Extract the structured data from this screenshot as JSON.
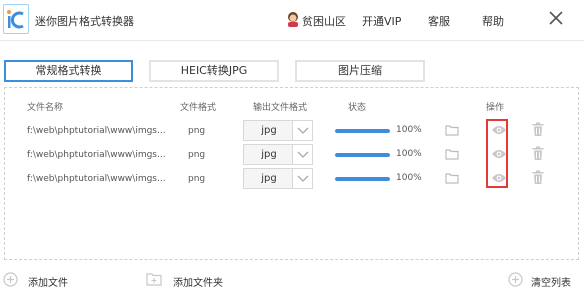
{
  "app": {
    "title": "迷你图片格式转换器"
  },
  "user": {
    "name": "贫困山区"
  },
  "nav": {
    "vip": "开通VIP",
    "support": "客服",
    "help": "帮助"
  },
  "tabs": [
    {
      "label": "常规格式转换",
      "active": true
    },
    {
      "label": "HEIC转换JPG",
      "active": false
    },
    {
      "label": "图片压缩",
      "active": false
    }
  ],
  "table": {
    "headers": {
      "name": "文件名称",
      "format": "文件格式",
      "output": "输出文件格式",
      "status": "状态",
      "actions": "操作"
    },
    "rows": [
      {
        "path": "f:\\web\\phptutorial\\www\\imgs...",
        "format": "png",
        "output": "jpg",
        "progress_percent": 100,
        "progress_text": "100%"
      },
      {
        "path": "f:\\web\\phptutorial\\www\\imgs...",
        "format": "png",
        "output": "jpg",
        "progress_percent": 100,
        "progress_text": "100%"
      },
      {
        "path": "f:\\web\\phptutorial\\www\\imgs...",
        "format": "png",
        "output": "jpg",
        "progress_percent": 100,
        "progress_text": "100%"
      }
    ]
  },
  "footer": {
    "add_file": "添加文件",
    "add_folder": "添加文件夹",
    "clear_list": "清空列表"
  },
  "colors": {
    "accent": "#3d8fde",
    "highlight": "#e53935",
    "icon_gray": "#c8c8c8"
  },
  "icons": {
    "row_actions": [
      "folder-icon",
      "eye-icon",
      "trash-icon"
    ]
  }
}
